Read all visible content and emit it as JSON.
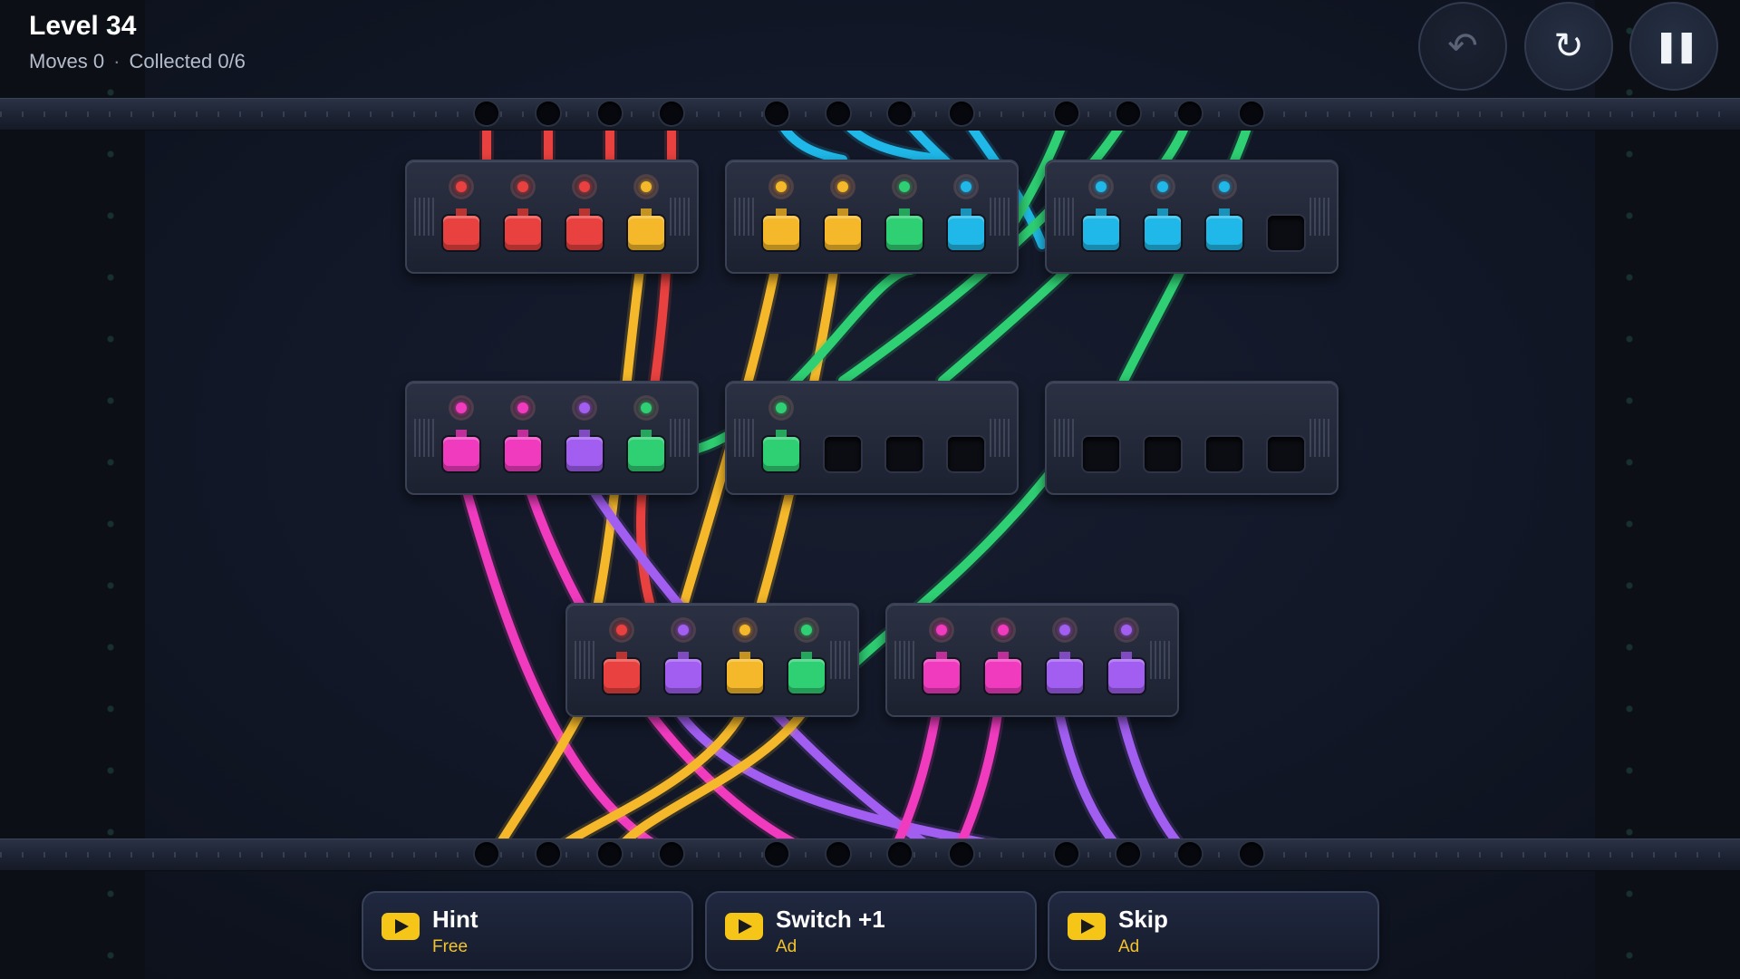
{
  "hud": {
    "level_title": "Level 34",
    "moves_text": "Moves 0",
    "separator": "·",
    "collected_text": "Collected 0/6"
  },
  "top_controls": {
    "undo_icon": "undo-icon",
    "undo_symbol": "↶",
    "restart_icon": "restart-icon",
    "restart_symbol": "↻",
    "pause_icon": "pause-icon",
    "pause_symbol": "❚❚"
  },
  "colors": {
    "red": "#e8413f",
    "yellow": "#f5b82a",
    "green": "#2fcf73",
    "cyan": "#1fb8e8",
    "magenta": "#f03bbf",
    "purple": "#a15ef0",
    "accent": "#f5c518"
  },
  "modules": [
    {
      "id": "A",
      "slots": [
        "red",
        "red",
        "red",
        "yellow"
      ]
    },
    {
      "id": "B",
      "slots": [
        "yellow",
        "yellow",
        "green",
        "cyan"
      ]
    },
    {
      "id": "C",
      "slots": [
        "cyan",
        "cyan",
        "cyan",
        "empty"
      ]
    },
    {
      "id": "D",
      "slots": [
        "magenta",
        "magenta",
        "purple",
        "green"
      ]
    },
    {
      "id": "E",
      "slots": [
        "green",
        "empty",
        "empty",
        "empty"
      ]
    },
    {
      "id": "F",
      "slots": [
        "empty",
        "empty",
        "empty",
        "empty"
      ]
    },
    {
      "id": "G",
      "slots": [
        "red",
        "purple",
        "yellow",
        "green"
      ]
    },
    {
      "id": "H",
      "slots": [
        "magenta",
        "magenta",
        "purple",
        "purple"
      ]
    }
  ],
  "actions": [
    {
      "label": "Hint",
      "sub": "Free"
    },
    {
      "label": "Switch +1",
      "sub": "Ad"
    },
    {
      "label": "Skip",
      "sub": "Ad"
    }
  ]
}
